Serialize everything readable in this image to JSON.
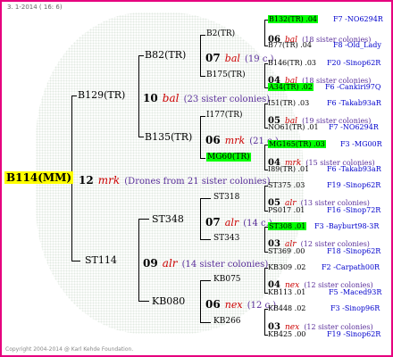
{
  "header": {
    "date": "3. 1-2014 ( 16: 6)"
  },
  "footer": {
    "copyright": "Copyright 2004-2014 @ Karl Kehde Foundation."
  },
  "root": {
    "name": "B114(MM)"
  },
  "gen1": {
    "num": "12",
    "cls": "mrk",
    "info": "(Drones from 21 sister colonies)",
    "father": {
      "name": "B129(TR)",
      "num": "10",
      "cls": "bal",
      "info": "(23 sister colonies)"
    },
    "mother": {
      "name": "ST114",
      "num": "09",
      "cls": "alr",
      "info": "(14 sister colonies)"
    }
  },
  "gen2": {
    "b82": {
      "name": "B82(TR)",
      "num": "07",
      "cls": "bal",
      "info": "(19 c.)"
    },
    "b135": {
      "name": "B135(TR)",
      "num": "06",
      "cls": "mrk",
      "info": "(21 c.)"
    },
    "st348": {
      "name": "ST348",
      "num": "07",
      "cls": "alr",
      "info": "(14 c.)"
    },
    "kb080": {
      "name": "KB080",
      "num": "06",
      "cls": "nex",
      "info": "(12 c.)"
    }
  },
  "gen3": {
    "b2": {
      "name": "B2(TR)",
      "num": "06",
      "cls": "bal",
      "info": "(18 sister colonies)"
    },
    "b175": {
      "name": "B175(TR)",
      "num": "04",
      "cls": "bal",
      "info": "(18 sister colonies)"
    },
    "i177": {
      "name": "I177(TR)",
      "num": "05",
      "cls": "bal",
      "info": "(19 sister colonies)"
    },
    "mg60": {
      "name": "MG60(TR)",
      "num": "04",
      "cls": "mrk",
      "info": "(15 sister colonies)"
    },
    "st318": {
      "name": "ST318",
      "num": "05",
      "cls": "alr",
      "info": "(13 sister colonies)"
    },
    "st343": {
      "name": "ST343",
      "num": "03",
      "cls": "alr",
      "info": "(12 sister colonies)"
    },
    "kb075": {
      "name": "KB075",
      "num": "04",
      "cls": "nex",
      "info": "(12 sister colonies)"
    },
    "kb266": {
      "name": "KB266",
      "num": "03",
      "cls": "nex",
      "info": "(12 sister colonies)"
    }
  },
  "gen4": [
    {
      "name": "B132(TR) .04",
      "src": "F7 -NO6294R"
    },
    {
      "name": "B77(TR) .04",
      "src": "F8 -Old_Lady"
    },
    {
      "name": "B146(TR) .03",
      "src": "F20 -Sinop62R"
    },
    {
      "name": "A34(TR) .02",
      "src": "F6 -Cankiri97Q"
    },
    {
      "name": "I51(TR) .03",
      "src": "F6 -Takab93aR"
    },
    {
      "name": "NO61(TR) .01",
      "src": "F7 -NO6294R"
    },
    {
      "name": "MG165(TR) .03",
      "src": "F3 -MG00R"
    },
    {
      "name": "I89(TR) .01",
      "src": "F6 -Takab93aR"
    },
    {
      "name": "ST375 .03",
      "src": "F19 -Sinop62R"
    },
    {
      "name": "PS017 .01",
      "src": "F16 -Sinop72R"
    },
    {
      "name": "ST308 .01",
      "src": "F3 -Bayburt98-3R"
    },
    {
      "name": "ST369 .00",
      "src": "F18 -Sinop62R"
    },
    {
      "name": "KB309 .02",
      "src": "F2 -Carpath00R"
    },
    {
      "name": "KB113 .01",
      "src": "F5 -Maced93R"
    },
    {
      "name": "KB448 .02",
      "src": "F3 -Sinop96R"
    },
    {
      "name": "KB425 .00",
      "src": "F19 -Sinop62R"
    }
  ]
}
